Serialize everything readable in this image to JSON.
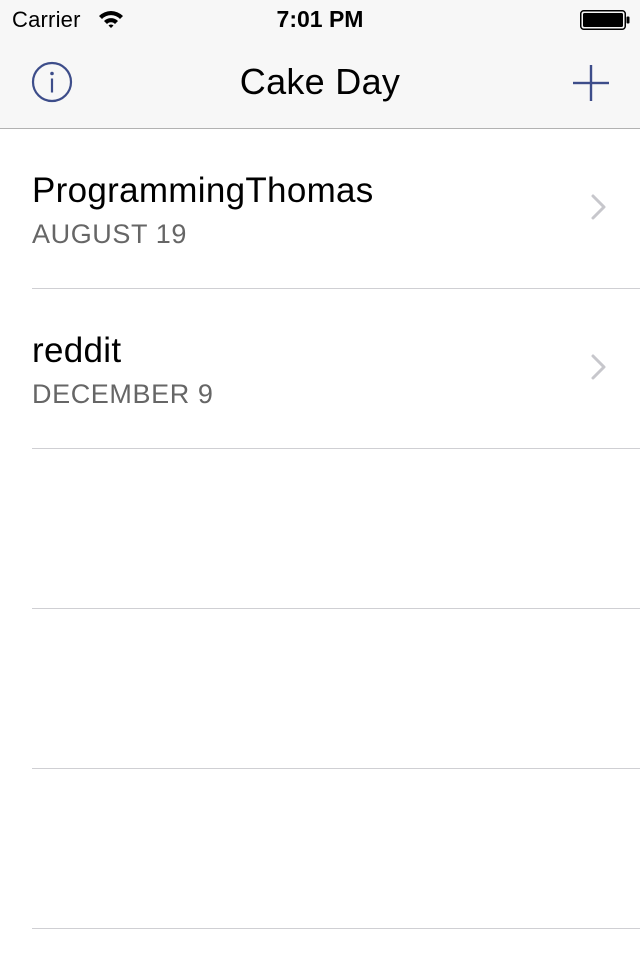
{
  "status_bar": {
    "carrier": "Carrier",
    "time": "7:01 PM",
    "wifi_icon": "wifi-icon",
    "battery_icon": "battery-full-icon"
  },
  "nav": {
    "title": "Cake Day",
    "left_icon": "info-icon",
    "right_icon": "plus-icon",
    "tint_color": "#3d4d8a"
  },
  "list": {
    "items": [
      {
        "name": "ProgrammingThomas",
        "date": "AUGUST 19"
      },
      {
        "name": "reddit",
        "date": "DECEMBER 9"
      }
    ],
    "empty_rows": 3
  }
}
